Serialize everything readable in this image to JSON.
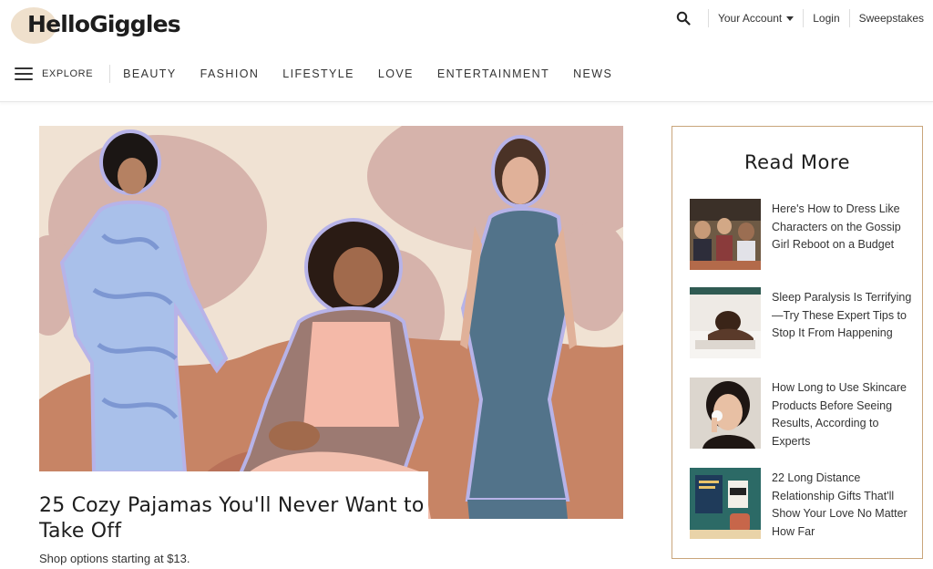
{
  "brand": {
    "name": "HelloGiggles"
  },
  "header": {
    "account_label": "Your Account",
    "login_label": "Login",
    "sweepstakes_label": "Sweepstakes"
  },
  "nav": {
    "explore_label": "EXPLORE",
    "items": [
      "BEAUTY",
      "FASHION",
      "LIFESTYLE",
      "LOVE",
      "ENTERTAINMENT",
      "NEWS"
    ]
  },
  "hero": {
    "headline": "25 Cozy Pajamas You'll Never Want to Take Off",
    "subtitle": "Shop options starting at $13."
  },
  "read_more": {
    "title": "Read More",
    "items": [
      {
        "label": "Here's How to Dress Like Characters on the Gossip Girl Reboot on a Budget"
      },
      {
        "label": "Sleep Paralysis Is Terrifying—Try These Expert Tips to Stop It From Happening"
      },
      {
        "label": "How Long to Use Skincare Products Before Seeing Results, According to Experts"
      },
      {
        "label": "22 Long Distance Relationship Gifts That'll Show Your Love No Matter How Far"
      }
    ]
  },
  "colors": {
    "accent_border": "#c9a57b",
    "hero_bg": "#f0e2d3",
    "hero_blob_pink": "#d6b3ab",
    "hero_blob_terracotta": "#c78465"
  }
}
